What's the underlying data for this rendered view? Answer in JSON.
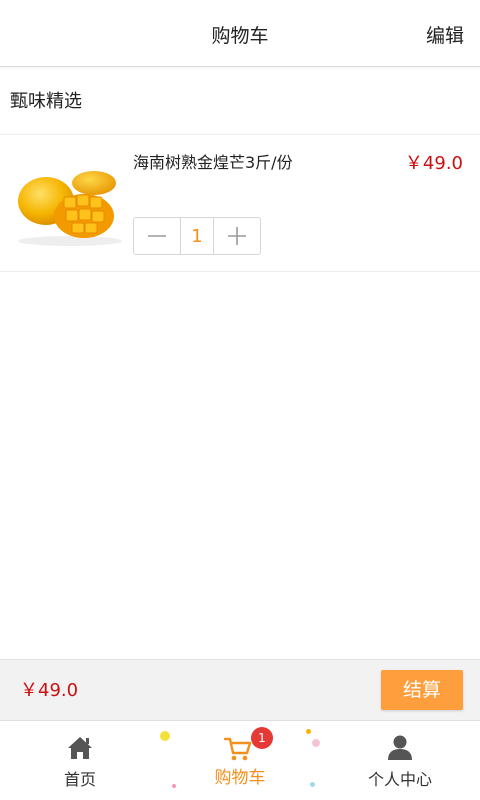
{
  "header": {
    "title": "购物车",
    "edit_label": "编辑"
  },
  "shop": {
    "name": "甄味精选"
  },
  "cart": {
    "items": [
      {
        "name": "海南树熟金煌芒3斤/份",
        "price": "￥49.0",
        "quantity": "1"
      }
    ]
  },
  "checkout": {
    "total": "￥49.0",
    "button_label": "结算"
  },
  "tabbar": {
    "tabs": [
      {
        "label": "首页",
        "icon": "home-icon"
      },
      {
        "label": "购物车",
        "icon": "cart-icon",
        "badge": "1",
        "active": true
      },
      {
        "label": "个人中心",
        "icon": "user-icon"
      }
    ]
  },
  "colors": {
    "accent": "#f5901c",
    "price": "#cc1010",
    "checkout_button": "#ff9e3d",
    "badge": "#e53935"
  }
}
